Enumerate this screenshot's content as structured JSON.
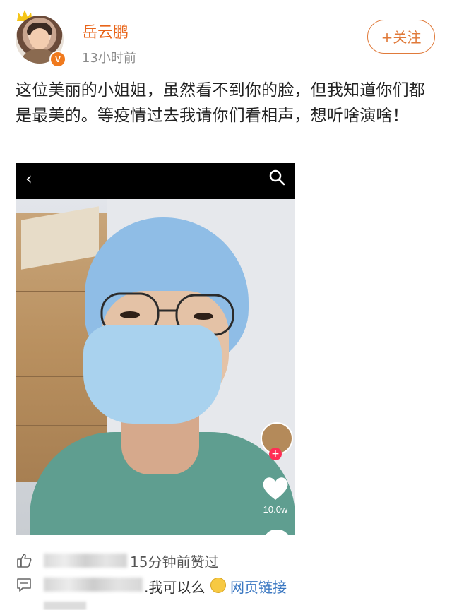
{
  "header": {
    "username": "岳云鹏",
    "time": "13小时前",
    "follow_label": "+关注",
    "verified_mark": "V"
  },
  "post": {
    "text": "这位美丽的小姐姐，虽然看不到你的脸，但我知道你们都是最美的。等疫情过去我请你们看相声，想听啥演啥！"
  },
  "video": {
    "back_icon": "‹",
    "search_icon": "search-icon",
    "likes": "10.0w",
    "follow_plus": "+"
  },
  "comments": [
    {
      "text": "15分钟前赞过",
      "icon": "thumbs-up-icon"
    },
    {
      "text": ".我可以么",
      "link": "网页链接",
      "icon": "comment-icon"
    }
  ],
  "colors": {
    "username": "#e8651a",
    "follow": "#e07a3a",
    "link": "#3b78c2"
  }
}
